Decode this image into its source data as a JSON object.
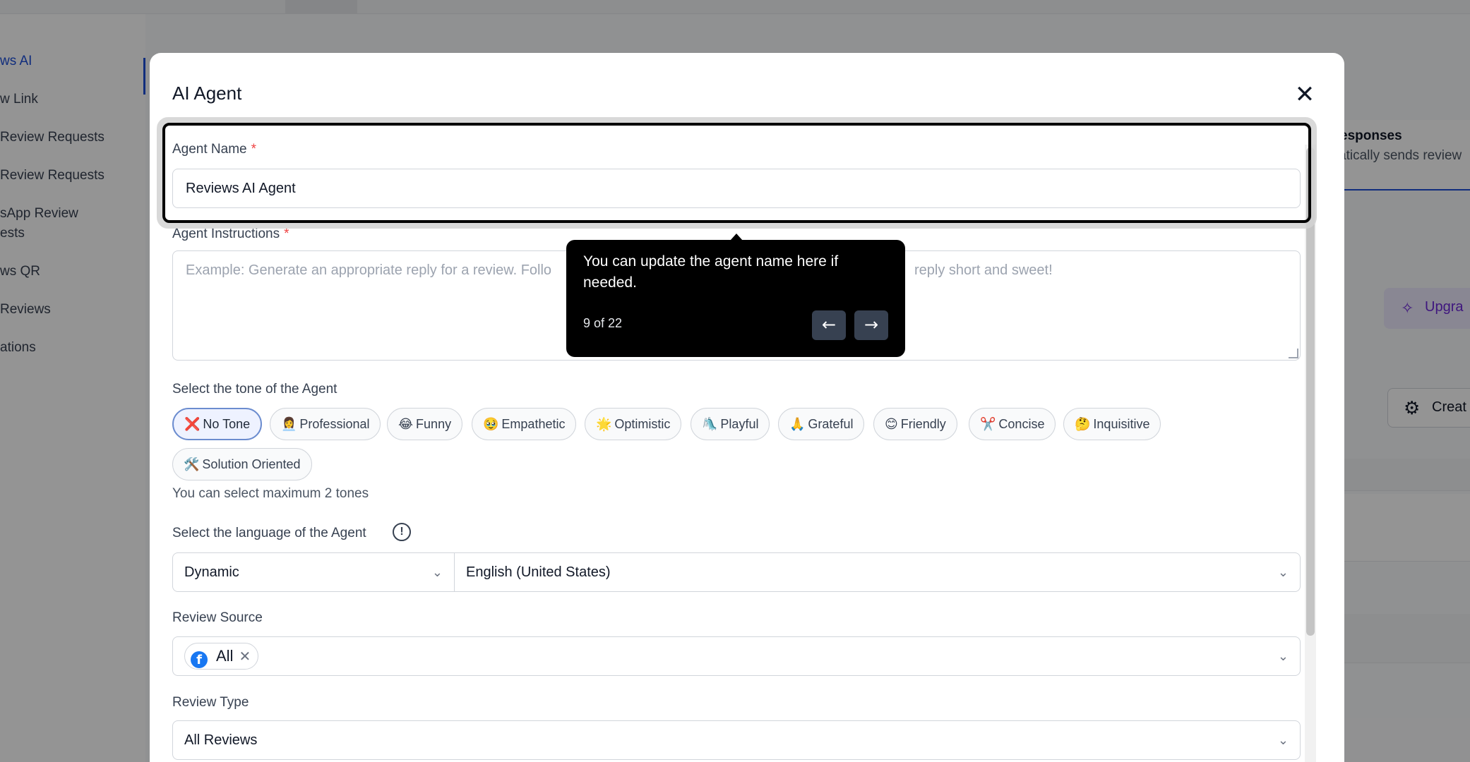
{
  "background": {
    "sidebar_items": [
      "ws AI",
      "w Link",
      "Review Requests",
      "Review Requests",
      "sApp Review",
      "ests",
      "ws QR",
      "Reviews",
      "ations"
    ],
    "card_title": "esponses",
    "card_subtitle": "atically sends review",
    "upgrade_label": "Upgra",
    "create_label": "Creat"
  },
  "modal": {
    "title": "AI Agent",
    "agent_name": {
      "label": "Agent Name",
      "required_mark": "*",
      "value": "Reviews AI Agent"
    },
    "agent_instructions": {
      "label": "Agent Instructions",
      "required_mark": "*",
      "placeholder_left": "Example: Generate an appropriate reply for a review. Follo",
      "placeholder_right": "reply short and sweet!"
    },
    "tone": {
      "label": "Select the tone of the Agent",
      "options": [
        {
          "emoji": "❌",
          "label": "No Tone",
          "selected": true
        },
        {
          "emoji": "👩‍💼",
          "label": "Professional",
          "selected": false
        },
        {
          "emoji": "😂",
          "label": "Funny",
          "selected": false
        },
        {
          "emoji": "🥹",
          "label": "Empathetic",
          "selected": false
        },
        {
          "emoji": "🌟",
          "label": "Optimistic",
          "selected": false
        },
        {
          "emoji": "🛝",
          "label": "Playful",
          "selected": false
        },
        {
          "emoji": "🙏",
          "label": "Grateful",
          "selected": false
        },
        {
          "emoji": "😊",
          "label": "Friendly",
          "selected": false
        },
        {
          "emoji": "✂️",
          "label": "Concise",
          "selected": false
        },
        {
          "emoji": "🤔",
          "label": "Inquisitive",
          "selected": false
        },
        {
          "emoji": "🛠️",
          "label": "Solution Oriented",
          "selected": false
        }
      ],
      "hint": "You can select maximum 2 tones"
    },
    "language": {
      "label": "Select the language of the Agent",
      "info_icon_glyph": "!",
      "mode_value": "Dynamic",
      "language_value": "English (United States)"
    },
    "review_source": {
      "label": "Review Source",
      "tag_label": "All",
      "tag_icon_glyph": "f",
      "remove_glyph": "✕"
    },
    "review_type": {
      "label": "Review Type",
      "value": "All Reviews"
    },
    "close_glyph": "✕",
    "chevron_glyph": "⌄"
  },
  "tooltip": {
    "message": "You can update the agent name here if needed.",
    "step": "9 of 22",
    "prev_glyph": "←",
    "next_glyph": "→"
  },
  "colors": {
    "required": "#ef4444",
    "highlight_border": "#000000",
    "tooltip_bg": "#000000",
    "selected_chip_border": "#6b8ccf",
    "facebook": "#1877f2"
  }
}
